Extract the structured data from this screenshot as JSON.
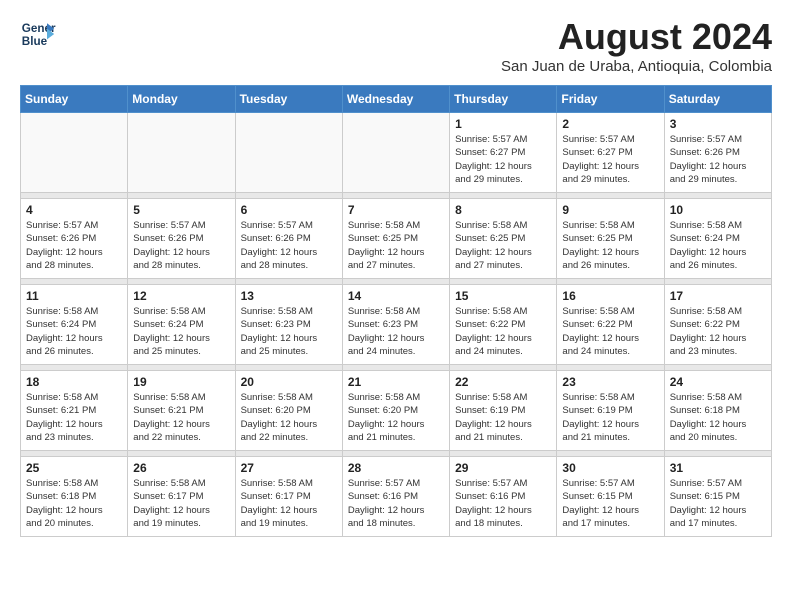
{
  "logo": {
    "line1": "General",
    "line2": "Blue"
  },
  "title": "August 2024",
  "subtitle": "San Juan de Uraba, Antioquia, Colombia",
  "days_header": [
    "Sunday",
    "Monday",
    "Tuesday",
    "Wednesday",
    "Thursday",
    "Friday",
    "Saturday"
  ],
  "weeks": [
    [
      {
        "day": "",
        "info": ""
      },
      {
        "day": "",
        "info": ""
      },
      {
        "day": "",
        "info": ""
      },
      {
        "day": "",
        "info": ""
      },
      {
        "day": "1",
        "info": "Sunrise: 5:57 AM\nSunset: 6:27 PM\nDaylight: 12 hours\nand 29 minutes."
      },
      {
        "day": "2",
        "info": "Sunrise: 5:57 AM\nSunset: 6:27 PM\nDaylight: 12 hours\nand 29 minutes."
      },
      {
        "day": "3",
        "info": "Sunrise: 5:57 AM\nSunset: 6:26 PM\nDaylight: 12 hours\nand 29 minutes."
      }
    ],
    [
      {
        "day": "4",
        "info": "Sunrise: 5:57 AM\nSunset: 6:26 PM\nDaylight: 12 hours\nand 28 minutes."
      },
      {
        "day": "5",
        "info": "Sunrise: 5:57 AM\nSunset: 6:26 PM\nDaylight: 12 hours\nand 28 minutes."
      },
      {
        "day": "6",
        "info": "Sunrise: 5:57 AM\nSunset: 6:26 PM\nDaylight: 12 hours\nand 28 minutes."
      },
      {
        "day": "7",
        "info": "Sunrise: 5:58 AM\nSunset: 6:25 PM\nDaylight: 12 hours\nand 27 minutes."
      },
      {
        "day": "8",
        "info": "Sunrise: 5:58 AM\nSunset: 6:25 PM\nDaylight: 12 hours\nand 27 minutes."
      },
      {
        "day": "9",
        "info": "Sunrise: 5:58 AM\nSunset: 6:25 PM\nDaylight: 12 hours\nand 26 minutes."
      },
      {
        "day": "10",
        "info": "Sunrise: 5:58 AM\nSunset: 6:24 PM\nDaylight: 12 hours\nand 26 minutes."
      }
    ],
    [
      {
        "day": "11",
        "info": "Sunrise: 5:58 AM\nSunset: 6:24 PM\nDaylight: 12 hours\nand 26 minutes."
      },
      {
        "day": "12",
        "info": "Sunrise: 5:58 AM\nSunset: 6:24 PM\nDaylight: 12 hours\nand 25 minutes."
      },
      {
        "day": "13",
        "info": "Sunrise: 5:58 AM\nSunset: 6:23 PM\nDaylight: 12 hours\nand 25 minutes."
      },
      {
        "day": "14",
        "info": "Sunrise: 5:58 AM\nSunset: 6:23 PM\nDaylight: 12 hours\nand 24 minutes."
      },
      {
        "day": "15",
        "info": "Sunrise: 5:58 AM\nSunset: 6:22 PM\nDaylight: 12 hours\nand 24 minutes."
      },
      {
        "day": "16",
        "info": "Sunrise: 5:58 AM\nSunset: 6:22 PM\nDaylight: 12 hours\nand 24 minutes."
      },
      {
        "day": "17",
        "info": "Sunrise: 5:58 AM\nSunset: 6:22 PM\nDaylight: 12 hours\nand 23 minutes."
      }
    ],
    [
      {
        "day": "18",
        "info": "Sunrise: 5:58 AM\nSunset: 6:21 PM\nDaylight: 12 hours\nand 23 minutes."
      },
      {
        "day": "19",
        "info": "Sunrise: 5:58 AM\nSunset: 6:21 PM\nDaylight: 12 hours\nand 22 minutes."
      },
      {
        "day": "20",
        "info": "Sunrise: 5:58 AM\nSunset: 6:20 PM\nDaylight: 12 hours\nand 22 minutes."
      },
      {
        "day": "21",
        "info": "Sunrise: 5:58 AM\nSunset: 6:20 PM\nDaylight: 12 hours\nand 21 minutes."
      },
      {
        "day": "22",
        "info": "Sunrise: 5:58 AM\nSunset: 6:19 PM\nDaylight: 12 hours\nand 21 minutes."
      },
      {
        "day": "23",
        "info": "Sunrise: 5:58 AM\nSunset: 6:19 PM\nDaylight: 12 hours\nand 21 minutes."
      },
      {
        "day": "24",
        "info": "Sunrise: 5:58 AM\nSunset: 6:18 PM\nDaylight: 12 hours\nand 20 minutes."
      }
    ],
    [
      {
        "day": "25",
        "info": "Sunrise: 5:58 AM\nSunset: 6:18 PM\nDaylight: 12 hours\nand 20 minutes."
      },
      {
        "day": "26",
        "info": "Sunrise: 5:58 AM\nSunset: 6:17 PM\nDaylight: 12 hours\nand 19 minutes."
      },
      {
        "day": "27",
        "info": "Sunrise: 5:58 AM\nSunset: 6:17 PM\nDaylight: 12 hours\nand 19 minutes."
      },
      {
        "day": "28",
        "info": "Sunrise: 5:57 AM\nSunset: 6:16 PM\nDaylight: 12 hours\nand 18 minutes."
      },
      {
        "day": "29",
        "info": "Sunrise: 5:57 AM\nSunset: 6:16 PM\nDaylight: 12 hours\nand 18 minutes."
      },
      {
        "day": "30",
        "info": "Sunrise: 5:57 AM\nSunset: 6:15 PM\nDaylight: 12 hours\nand 17 minutes."
      },
      {
        "day": "31",
        "info": "Sunrise: 5:57 AM\nSunset: 6:15 PM\nDaylight: 12 hours\nand 17 minutes."
      }
    ]
  ]
}
